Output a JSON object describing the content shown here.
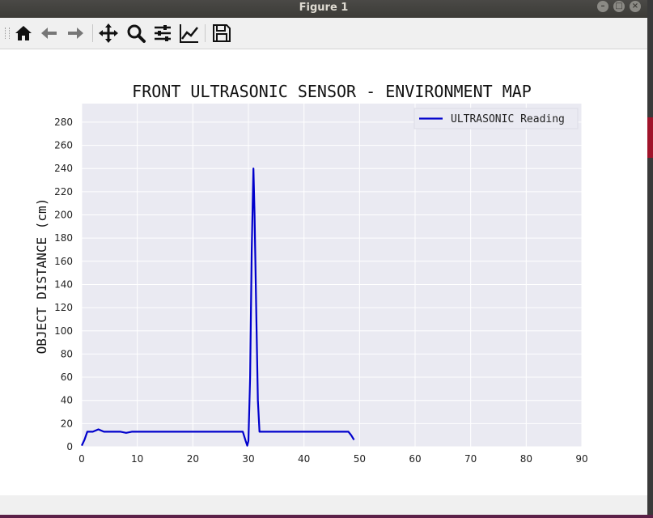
{
  "window": {
    "title": "Figure 1"
  },
  "toolbar": {
    "buttons": [
      {
        "name": "home-icon"
      },
      {
        "name": "back-arrow-icon"
      },
      {
        "name": "forward-arrow-icon"
      },
      {
        "name": "pan-move-icon"
      },
      {
        "name": "zoom-magnifier-icon"
      },
      {
        "name": "configure-subplots-icon"
      },
      {
        "name": "edit-axis-icon"
      },
      {
        "name": "save-floppy-icon"
      }
    ]
  },
  "colors": {
    "plot_bg": "#eaeaf2",
    "grid": "#ffffff",
    "line": "#0000cc",
    "tick_text": "#222222"
  },
  "chart_data": {
    "type": "line",
    "title": "FRONT ULTRASONIC SENSOR - ENVIRONMENT MAP",
    "xlabel": "",
    "ylabel": "OBJECT DISTANCE (cm)",
    "xlim": [
      0,
      90
    ],
    "ylim": [
      0,
      296
    ],
    "xticks": [
      0,
      10,
      20,
      30,
      40,
      50,
      60,
      70,
      80,
      90
    ],
    "yticks": [
      0,
      20,
      40,
      60,
      80,
      100,
      120,
      140,
      160,
      180,
      200,
      220,
      240,
      260,
      280
    ],
    "grid": true,
    "legend_position": "top-right",
    "series": [
      {
        "name": "ULTRASONIC Reading",
        "color": "#0000cc",
        "x": [
          0,
          0.5,
          1,
          2,
          3,
          4,
          5,
          6,
          7,
          8,
          9,
          10,
          12,
          14,
          16,
          18,
          20,
          22,
          24,
          26,
          28,
          29,
          29.5,
          29.8,
          30,
          30.3,
          30.6,
          30.9,
          31.1,
          31.4,
          31.7,
          32,
          33,
          35,
          38,
          41,
          44,
          47,
          48,
          48.5,
          49
        ],
        "y": [
          1,
          6,
          13,
          13,
          15,
          13,
          13,
          13,
          13,
          12,
          13,
          13,
          13,
          13,
          13,
          13,
          13,
          13,
          13,
          13,
          13,
          13,
          5,
          1,
          5,
          60,
          170,
          240,
          200,
          120,
          40,
          13,
          13,
          13,
          13,
          13,
          13,
          13,
          13,
          10,
          6
        ]
      }
    ]
  }
}
